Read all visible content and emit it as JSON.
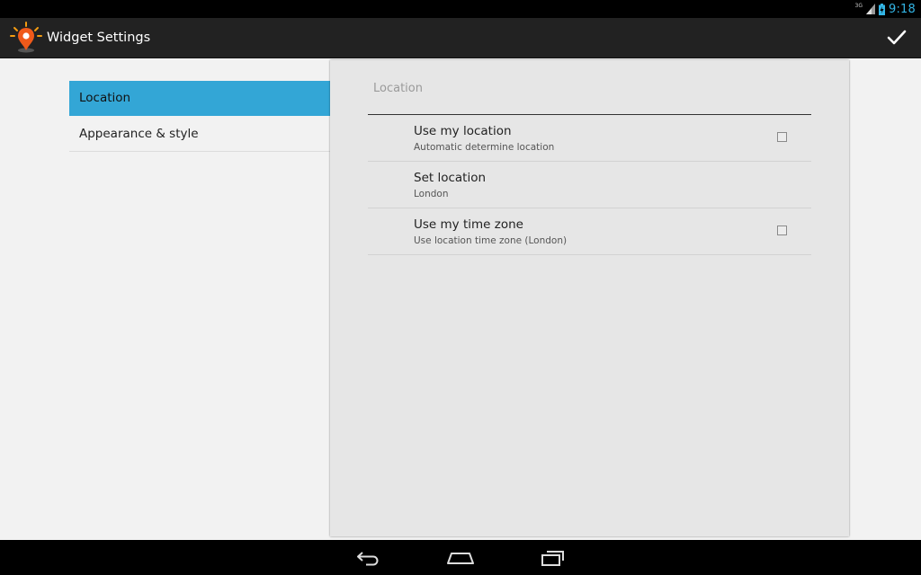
{
  "status_bar": {
    "network": "3G",
    "time": "9:18"
  },
  "action_bar": {
    "title": "Widget Settings",
    "confirm_icon": "checkmark-icon"
  },
  "headers": [
    {
      "label": "Location",
      "selected": true
    },
    {
      "label": "Appearance & style",
      "selected": false
    }
  ],
  "panel": {
    "category_title": "Location",
    "preferences": [
      {
        "title": "Use my location",
        "summary": "Automatic determine location",
        "has_checkbox": true,
        "checked": false
      },
      {
        "title": "Set location",
        "summary": "London",
        "has_checkbox": false
      },
      {
        "title": "Use my time zone",
        "summary": "Use location time zone (London)",
        "has_checkbox": true,
        "checked": false
      }
    ]
  },
  "nav_bar": {
    "icons": [
      "back-icon",
      "home-icon",
      "recent-apps-icon"
    ]
  },
  "colors": {
    "accent": "#33b5e5",
    "selected_header": "#33a6d6",
    "action_bar": "#222222",
    "panel": "#e6e6e6"
  }
}
